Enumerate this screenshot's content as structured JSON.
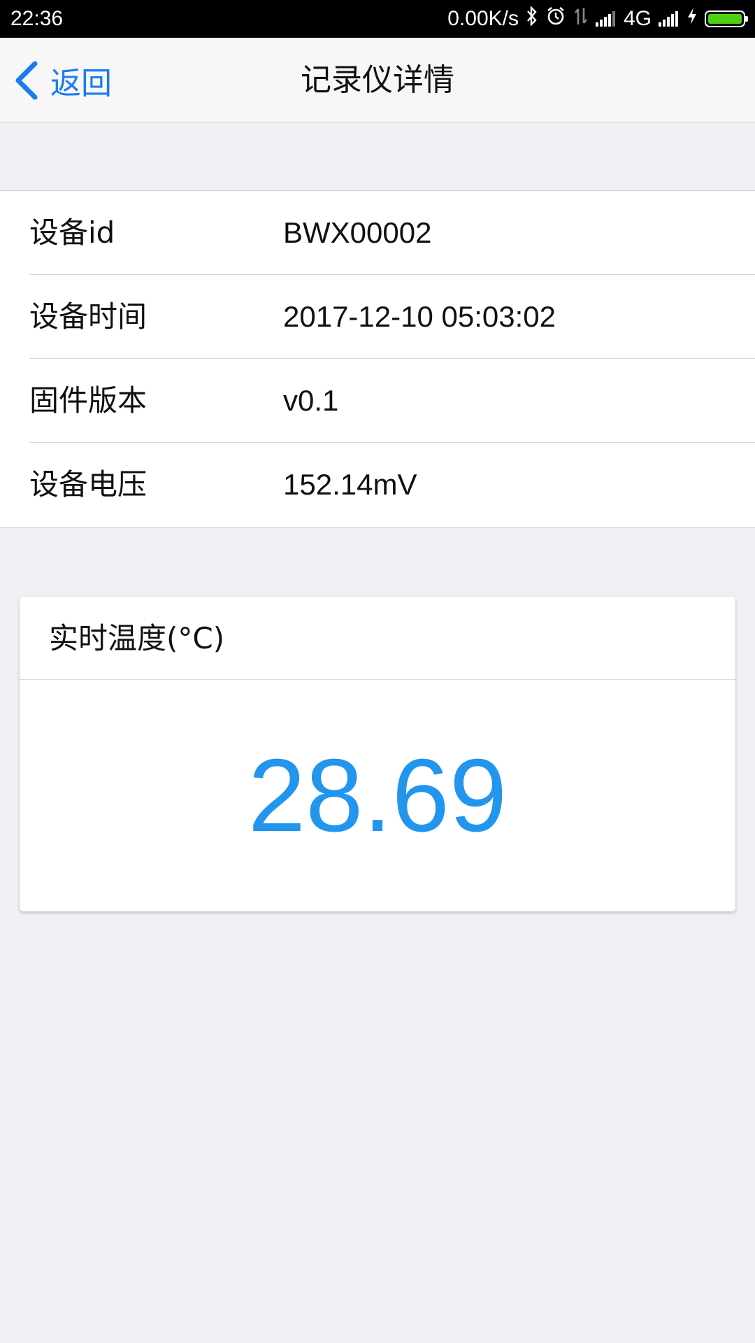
{
  "status_bar": {
    "time": "22:36",
    "net_speed": "0.00K/s",
    "network_type": "4G",
    "icons": [
      "bluetooth-icon",
      "alarm-icon",
      "data-arrows-icon",
      "signal-icon",
      "signal-icon",
      "charging-icon",
      "battery-icon"
    ],
    "battery_color": "#4cd213"
  },
  "nav": {
    "back_label": "返回",
    "back_icon": "chevron-left-icon",
    "title": "记录仪详情",
    "accent_color": "#1b7cf0"
  },
  "info": {
    "rows": [
      {
        "label": "设备id",
        "value": "BWX00002"
      },
      {
        "label": "设备时间",
        "value": "2017-12-10 05:03:02"
      },
      {
        "label": "固件版本",
        "value": "v0.1"
      },
      {
        "label": "设备电压",
        "value": "152.14mV"
      }
    ]
  },
  "temperature": {
    "title": "实时温度(°C)",
    "value": "28.69",
    "value_color": "#2296ee"
  }
}
